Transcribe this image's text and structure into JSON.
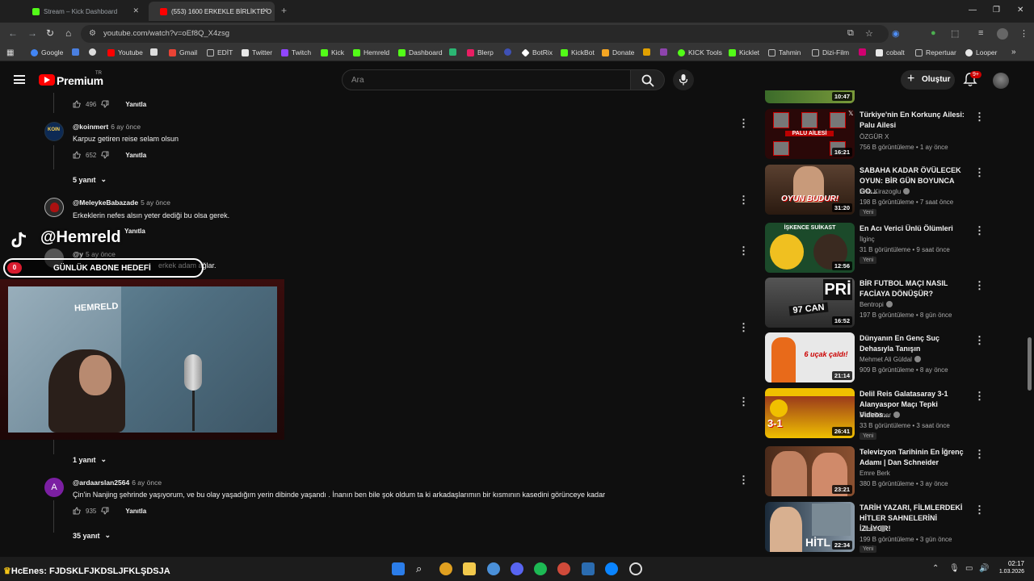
{
  "browser": {
    "tabs": [
      {
        "label": "Stream – Kick Dashboard",
        "active": false,
        "icon_color": "#53fc18"
      },
      {
        "label": "(553) 1600 ERKEKLE BİRLİKTE O",
        "active": true,
        "icon_color": "#ff0000"
      }
    ],
    "new_tab_label": "+",
    "url": "youtube.com/watch?v=oEf8Q_X4zsg",
    "bookmarks": [
      {
        "label": "Google",
        "icon_color": "#4285f4"
      },
      {
        "label": "Youtube",
        "icon_color": "#ff0000"
      },
      {
        "label": "Gmail",
        "icon_color": "#ea4335"
      },
      {
        "label": "EDİT",
        "icon_color": "#8a8a8a"
      },
      {
        "label": "Twitter",
        "icon_color": "#e8e8e8"
      },
      {
        "label": "Twitch",
        "icon_color": "#9146ff"
      },
      {
        "label": "Kick",
        "icon_color": "#53fc18"
      },
      {
        "label": "Hemreld",
        "icon_color": "#53fc18"
      },
      {
        "label": "Dashboard",
        "icon_color": "#53fc18"
      },
      {
        "label": "Blerp",
        "icon_color": "#e91e63"
      },
      {
        "label": "BotRix",
        "icon_color": "#ffffff"
      },
      {
        "label": "KickBot",
        "icon_color": "#53fc18"
      },
      {
        "label": "Donate",
        "icon_color": "#f5a623"
      },
      {
        "label": "KICK Tools",
        "icon_color": "#53fc18"
      },
      {
        "label": "Kicklet",
        "icon_color": "#53fc18"
      },
      {
        "label": "Tahmin",
        "icon_color": "#8a8a8a"
      },
      {
        "label": "Dizi-Film",
        "icon_color": "#8a8a8a"
      },
      {
        "label": "cobalt",
        "icon_color": "#e8e8e8"
      },
      {
        "label": "Repertuar",
        "icon_color": "#8a8a8a"
      },
      {
        "label": "Looper",
        "icon_color": "#e8e8e8"
      }
    ]
  },
  "header": {
    "brand": "Premium",
    "region": "TR",
    "search_placeholder": "Ara",
    "create_label": "Oluştur",
    "notification_badge": "9+"
  },
  "comments": [
    {
      "likes": "496",
      "reply_label": "Yanıtla"
    },
    {
      "author": "@koinmert",
      "time": "6 ay önce",
      "text": "Karpuz getiren reise selam olsun",
      "likes": "652",
      "reply_label": "Yanıtla",
      "replies": "5 yanıt",
      "avatar_color": "#1e3a6e"
    },
    {
      "author": "@MeleykeBabazade",
      "time": "5 ay önce",
      "text": "Erkeklerin nefes alsın yeter dediği bu olsa gerek.",
      "reply_label": "Yanıtla",
      "avatar_color": "#6b1c1c"
    },
    {
      "author": "@y",
      "time": "5 ay önce",
      "text": "erkek adam ağlar.",
      "avatar_color": "#555555"
    },
    {
      "replies": "1 yanıt"
    },
    {
      "author": "@ardaarslan2564",
      "time": "6 ay önce",
      "text": "Çin'in Nanjing şehrinde yaşıyorum, ve bu olay yaşadığım yerin dibinde yaşandı . İnanın ben bile şok oldum ta ki arkadaşlarımın bir kısmının kasedini görünceye kadar",
      "likes": "935",
      "reply_label": "Yanıtla",
      "replies": "35 yanıt",
      "avatar_letter": "A",
      "avatar_color": "#7b1fa2"
    }
  ],
  "videos": [
    {
      "duration": "10:47"
    },
    {
      "title": "Türkiye'nin En Korkunç Ailesi: Palu Ailesi",
      "channel": "ÖZGÜR X",
      "verified": false,
      "meta": "756 B görüntüleme • 1 ay önce",
      "duration": "16:21",
      "thumb_text": "PALU AİLESİ",
      "thumb_color": "#2a0808",
      "new": ""
    },
    {
      "title": "SABAHA KADAR ÖVÜLECEK OYUN: BİR GÜN BOYUNCA GO...",
      "channel": "Enis Kirazoglu",
      "verified": true,
      "meta": "198 B görüntüleme • 7 saat önce",
      "duration": "31:20",
      "thumb_text": "OYUN BUDUR!",
      "thumb_color": "#3a2a1c",
      "new": "Yeni"
    },
    {
      "title": "En Acı Verici Ünlü Ölümleri",
      "channel": "İlginç",
      "verified": false,
      "meta": "31 B görüntüleme • 9 saat önce",
      "duration": "12:56",
      "thumb_text": "İŞKENCE SUİKAST",
      "thumb_color": "#1b4a2a",
      "new": "Yeni"
    },
    {
      "title": "BİR FUTBOL MAÇI NASIL FACİAYA DÖNÜŞÜR?",
      "channel": "Bentropi",
      "verified": true,
      "meta": "197 B görüntüleme • 8 gün önce",
      "duration": "16:52",
      "thumb_text": "97 CAN",
      "thumb_color": "#3a3a3a",
      "new": ""
    },
    {
      "title": "Dünyanın En Genç Suç Dehasıyla Tanışın",
      "channel": "Mehmet Ali Güldal",
      "verified": true,
      "meta": "909 B görüntüleme • 8 ay önce",
      "duration": "21:14",
      "thumb_text": "6 uçak çaldı!",
      "thumb_color": "#e0e0e0",
      "new": ""
    },
    {
      "title": "Delil Reis Galatasaray 3-1 Alanyaspor Maçı Tepki Videos...",
      "channel": "Delil Süner",
      "verified": true,
      "meta": "33 B görüntüleme • 3 saat önce",
      "duration": "26:41",
      "thumb_text": "3-1",
      "thumb_color": "#7a1a1a",
      "new": "Yeni"
    },
    {
      "title": "Televizyon Tarihinin En İğrenç Adamı | Dan Schneider",
      "channel": "Emre Berk",
      "verified": false,
      "meta": "380 B görüntüleme • 3 ay önce",
      "duration": "23:21",
      "thumb_text": "",
      "thumb_color": "#4a2a1a",
      "new": ""
    },
    {
      "title": "TARİH YAZARI, FİLMLERDEKİ HİTLER SAHNELERİNİ İZLİYOR!",
      "channel": "Literat",
      "verified": true,
      "meta": "199 B görüntüleme • 3 gün önce",
      "duration": "22:34",
      "thumb_text": "HİTL",
      "thumb_color": "#5a6a7a",
      "new": "Yeni"
    }
  ],
  "overlay": {
    "tiktok_handle": "@Hemreld",
    "goal_count": "0",
    "goal_label": "GÜNLÜK ABONE HEDEFİ",
    "webcam_logo": "HEMRELD"
  },
  "taskbar": {
    "chat_user": "HcEnes:",
    "chat_message": "FJDSKLFJKDSLJFKLŞDSJA",
    "time": "02:17",
    "date": "1.03.2026"
  }
}
